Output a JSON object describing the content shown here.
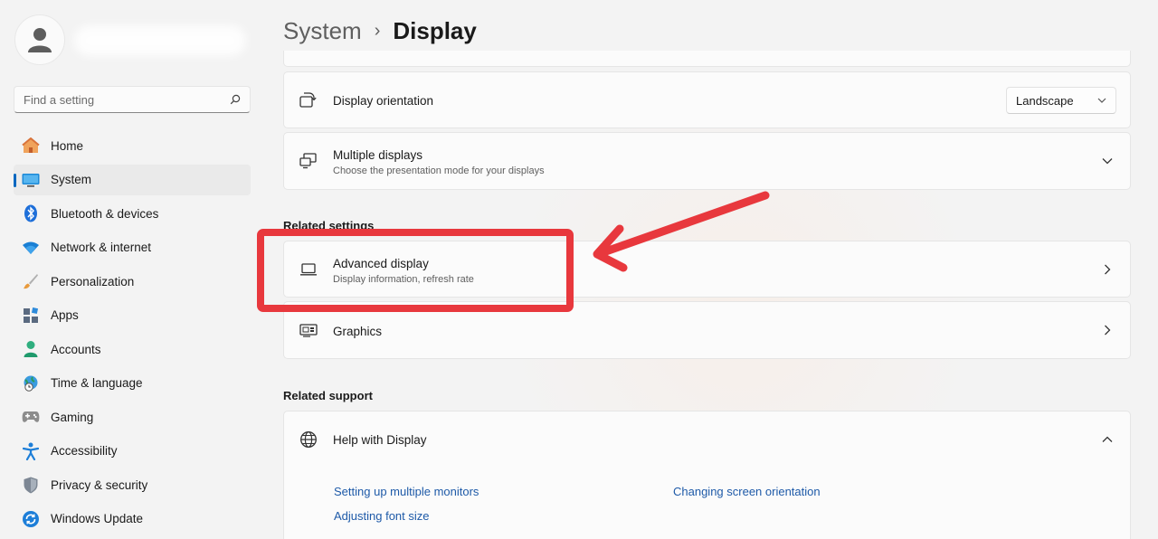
{
  "sidebar": {
    "search_placeholder": "Find a setting",
    "items": [
      {
        "label": "Home",
        "icon": "home-icon"
      },
      {
        "label": "System",
        "icon": "monitor-icon",
        "active": true
      },
      {
        "label": "Bluetooth & devices",
        "icon": "bluetooth-icon"
      },
      {
        "label": "Network & internet",
        "icon": "wifi-icon"
      },
      {
        "label": "Personalization",
        "icon": "brush-icon"
      },
      {
        "label": "Apps",
        "icon": "apps-icon"
      },
      {
        "label": "Accounts",
        "icon": "person-icon"
      },
      {
        "label": "Time & language",
        "icon": "globe-clock-icon"
      },
      {
        "label": "Gaming",
        "icon": "gamepad-icon"
      },
      {
        "label": "Accessibility",
        "icon": "accessibility-icon"
      },
      {
        "label": "Privacy & security",
        "icon": "shield-icon"
      },
      {
        "label": "Windows Update",
        "icon": "update-icon"
      }
    ]
  },
  "breadcrumb": {
    "parent": "System",
    "separator": "›",
    "current": "Display"
  },
  "cards": {
    "orientation": {
      "title": "Display orientation",
      "value": "Landscape"
    },
    "multiple": {
      "title": "Multiple displays",
      "subtitle": "Choose the presentation mode for your displays"
    },
    "advanced": {
      "title": "Advanced display",
      "subtitle": "Display information, refresh rate"
    },
    "graphics": {
      "title": "Graphics"
    },
    "help": {
      "title": "Help with Display"
    }
  },
  "sections": {
    "related_settings": "Related settings",
    "related_support": "Related support"
  },
  "links": [
    "Setting up multiple monitors",
    "Changing screen orientation",
    "Adjusting font size"
  ],
  "colors": {
    "accent": "#0067c0",
    "annotation": "#e8383d",
    "link": "#1e5aa8"
  }
}
